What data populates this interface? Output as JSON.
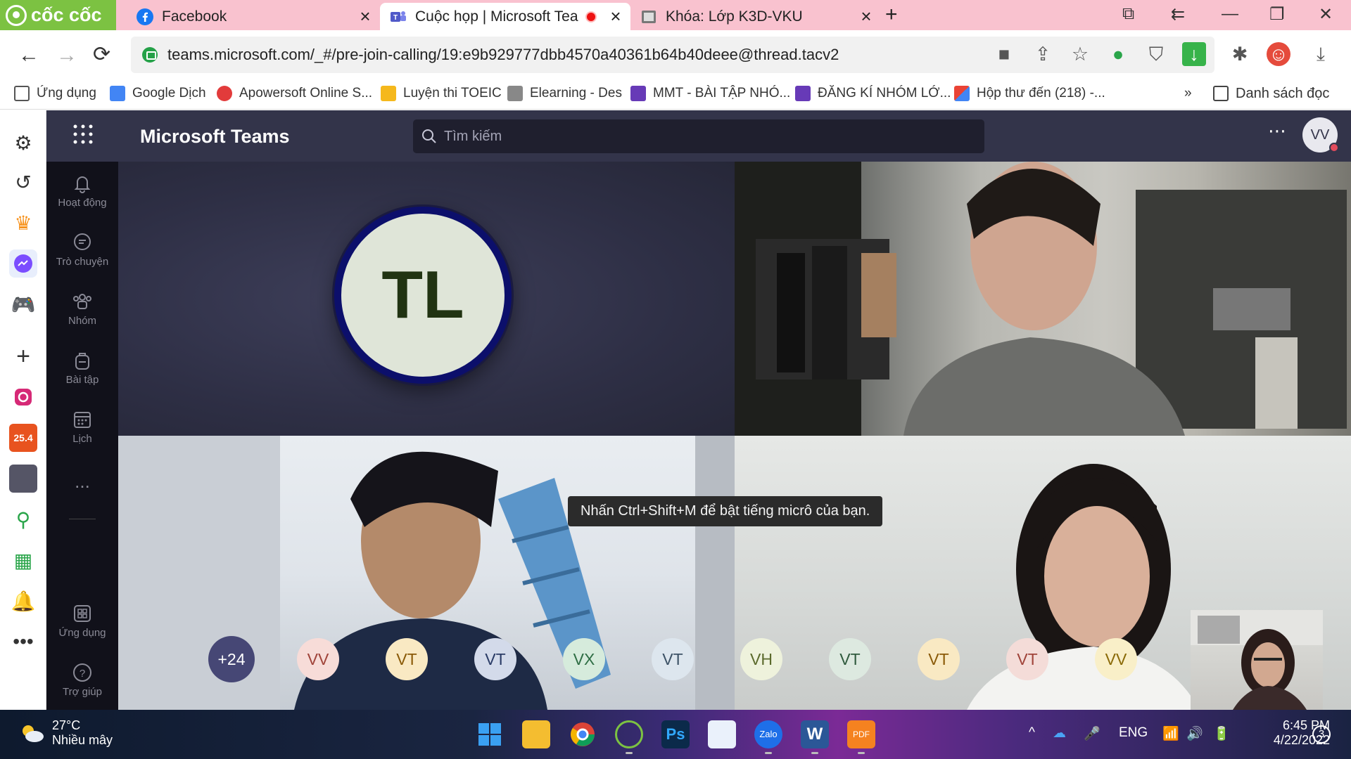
{
  "browser": {
    "logo": "cốc cốc",
    "tabs": [
      {
        "title": "Facebook",
        "favicon": "facebook-icon"
      },
      {
        "title": "Cuộc họp | Microsoft Tea",
        "favicon": "teams-icon",
        "recording": true
      },
      {
        "title": "Khóa: Lớp K3D-VKU",
        "favicon": "elearning-icon"
      }
    ],
    "url": "teams.microsoft.com/_#/pre-join-calling/19:e9b929777dbb4570a40361b64b40deee@thread.tacv2",
    "bookmarks": [
      {
        "label": "Ứng dụng",
        "icon": "apps-grid-icon"
      },
      {
        "label": "Google Dịch",
        "icon": "google-translate-icon"
      },
      {
        "label": "Apowersoft Online S...",
        "icon": "apowersoft-icon"
      },
      {
        "label": "Luyện thi TOEIC",
        "icon": "toeic-icon"
      },
      {
        "label": "Elearning - Des",
        "icon": "elearning-icon"
      },
      {
        "label": "MMT - BÀI TẬP NHÓ...",
        "icon": "forms-icon"
      },
      {
        "label": "ĐĂNG KÍ NHÓM LỚ...",
        "icon": "forms-icon"
      },
      {
        "label": "Hộp thư đến (218) -...",
        "icon": "gmail-icon"
      }
    ],
    "bookmarks_overflow": "»",
    "reading_list": "Danh sách đọc"
  },
  "teams": {
    "title": "Microsoft Teams",
    "search_placeholder": "Tìm kiếm",
    "user_initials": "VV",
    "rail": [
      {
        "label": "Hoạt động",
        "icon": "bell-icon"
      },
      {
        "label": "Trò chuyện",
        "icon": "chat-icon"
      },
      {
        "label": "Nhóm",
        "icon": "teams-group-icon"
      },
      {
        "label": "Bài tập",
        "icon": "backpack-icon"
      },
      {
        "label": "Lịch",
        "icon": "calendar-icon"
      },
      {
        "label": "Ứng dụng",
        "icon": "apps-icon"
      },
      {
        "label": "Trợ giúp",
        "icon": "help-icon"
      }
    ],
    "rail_more": "...",
    "main_speaker_initials": "TL",
    "toast": "Nhấn Ctrl+Shift+M để bật tiếng micrô của bạn.",
    "participants_overflow": "+24",
    "participants": [
      {
        "initials": "VV",
        "bg": "#f7dcd8",
        "fg": "#a0443a"
      },
      {
        "initials": "VT",
        "bg": "#f9e9c3",
        "fg": "#8a5a08"
      },
      {
        "initials": "VT",
        "bg": "#d3daea",
        "fg": "#2a3b66"
      },
      {
        "initials": "VX",
        "bg": "#d6ebdc",
        "fg": "#2f6e45"
      },
      {
        "initials": "VT",
        "bg": "#dde6ee",
        "fg": "#3d5266"
      },
      {
        "initials": "VH",
        "bg": "#eef2dc",
        "fg": "#5b6a2c"
      },
      {
        "initials": "VT",
        "bg": "#dde9e0",
        "fg": "#2f5a3d"
      },
      {
        "initials": "VT",
        "bg": "#f9e9c3",
        "fg": "#8a5a08"
      },
      {
        "initials": "VT",
        "bg": "#f4dcd8",
        "fg": "#a0443a"
      },
      {
        "initials": "VV",
        "bg": "#f9efc8",
        "fg": "#8a6a08"
      }
    ]
  },
  "taskbar": {
    "temperature": "27°C",
    "weather": "Nhiều mây",
    "language": "ENG",
    "time": "6:45 PM",
    "date": "4/22/2022",
    "notifications": "3"
  }
}
